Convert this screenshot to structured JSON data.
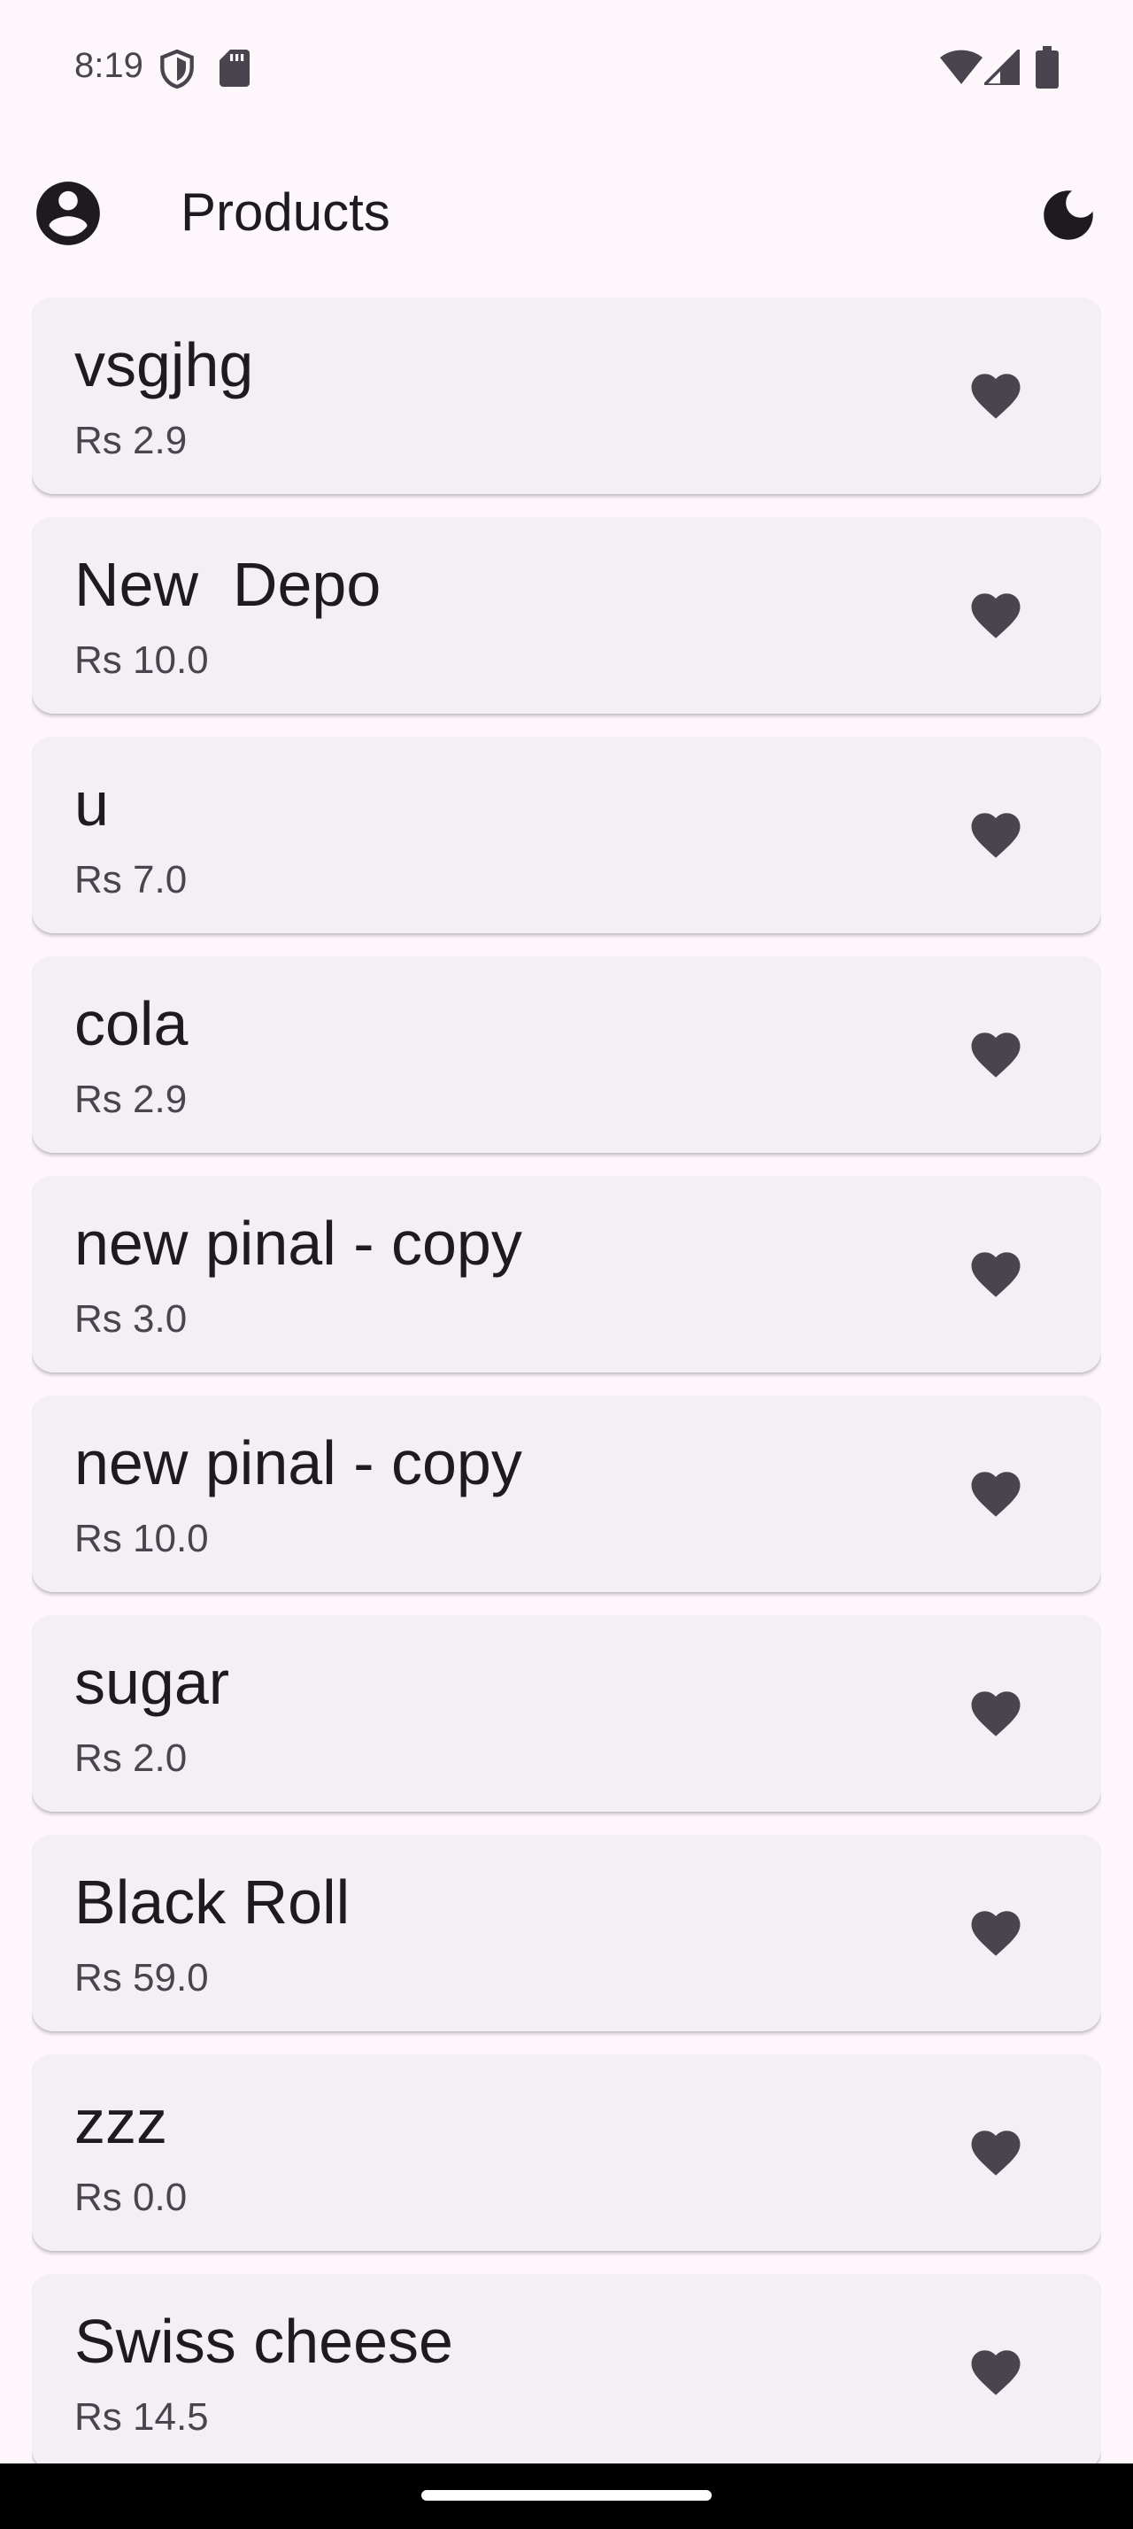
{
  "status_bar": {
    "time": "8:19",
    "icons": [
      "shield-icon",
      "sd-card-icon",
      "wifi-icon",
      "cellular-signal-icon",
      "battery-icon"
    ]
  },
  "app_bar": {
    "title": "Products",
    "account_icon": "account-circle-icon",
    "theme_icon": "dark-mode-moon-icon"
  },
  "products": [
    {
      "name": "vsgjhg",
      "price": "Rs 2.9"
    },
    {
      "name": "New  Depo",
      "price": "Rs 10.0"
    },
    {
      "name": "u",
      "price": "Rs 7.0"
    },
    {
      "name": "cola",
      "price": "Rs 2.9"
    },
    {
      "name": "new pinal - copy",
      "price": "Rs 3.0"
    },
    {
      "name": "new pinal - copy",
      "price": "Rs 10.0"
    },
    {
      "name": "sugar",
      "price": "Rs 2.0"
    },
    {
      "name": "Black Roll",
      "price": "Rs 59.0"
    },
    {
      "name": "zzz",
      "price": "Rs 0.0"
    },
    {
      "name": "Swiss cheese",
      "price": "Rs 14.5"
    }
  ],
  "favorite_icon": "heart-icon",
  "colors": {
    "background": "#fdf7fc",
    "card": "#f4eff4",
    "icon": "#49454f",
    "text": "#1d1b20",
    "nav_bar": "#000000"
  }
}
